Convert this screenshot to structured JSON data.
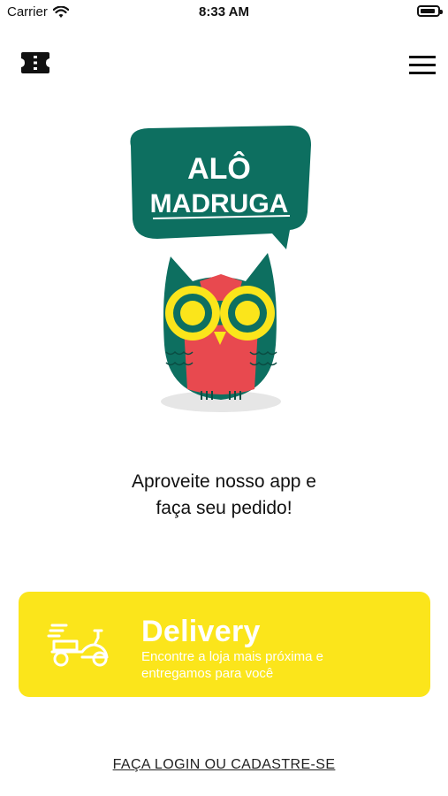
{
  "status_bar": {
    "carrier": "Carrier",
    "time": "8:33 AM"
  },
  "header": {
    "ticket_icon": "ticket-icon",
    "menu_icon": "hamburger-menu-icon"
  },
  "logo": {
    "line1": "ALÔ",
    "line2": "MADRUGA"
  },
  "tagline": {
    "line1": "Aproveite nosso app e",
    "line2": "faça seu pedido!"
  },
  "delivery": {
    "title": "Delivery",
    "description": "Encontre a loja mais próxima e entregamos para você",
    "icon": "scooter-icon",
    "background_color": "#fbe51b"
  },
  "login": {
    "label": "FAÇA LOGIN OU CADASTRE-SE"
  },
  "colors": {
    "brand_green": "#0d6f60",
    "brand_red": "#e8494f",
    "brand_yellow": "#fbe51b"
  }
}
